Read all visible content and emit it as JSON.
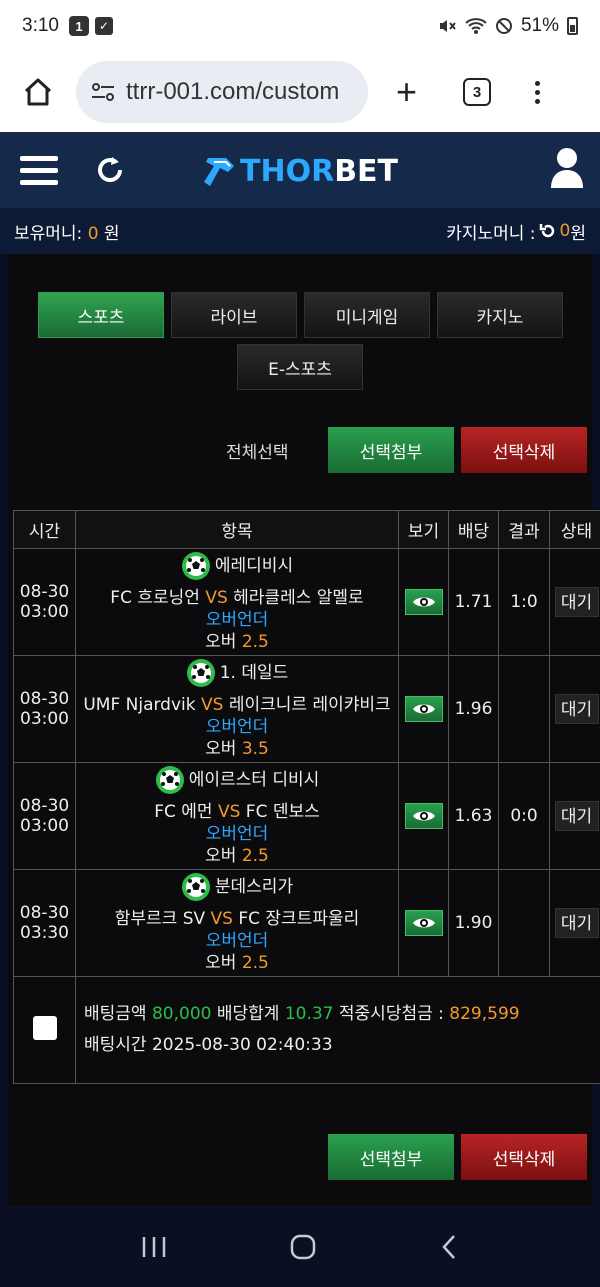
{
  "status_bar": {
    "time": "3:10",
    "notif_count": "1",
    "battery": "51%"
  },
  "browser": {
    "url": "ttrr-001.com/custom",
    "tab_count": "3"
  },
  "site": {
    "logo_part1": "THOR",
    "logo_part2": "BET"
  },
  "money": {
    "holding_label": "보유머니: ",
    "holding_value": "0",
    "holding_unit": " 원",
    "casino_label": "카지노머니 : ",
    "casino_value": "0",
    "casino_unit": " 원"
  },
  "categories": [
    "스포츠",
    "라이브",
    "미니게임",
    "카지노",
    "E-스포츠"
  ],
  "actions": {
    "select_all": "전체선택",
    "attach": "선택첨부",
    "delete": "선택삭제"
  },
  "table": {
    "headers": [
      "시간",
      "항목",
      "보기",
      "배당",
      "결과",
      "상태"
    ],
    "rows": [
      {
        "date": "08-30",
        "time": "03:00",
        "league": "에레디비시",
        "home": "FC 흐로닝언",
        "vs": "VS",
        "away": "헤라클레스 알멜로",
        "market": "오버언더",
        "pick": "오버",
        "line": "2.5",
        "odds": "1.71",
        "result": "1:0",
        "status": "대기"
      },
      {
        "date": "08-30",
        "time": "03:00",
        "league": "1. 데일드",
        "home": "UMF Njardvik",
        "vs": "VS",
        "away": "레이크니르 레이캬비크",
        "market": "오버언더",
        "pick": "오버",
        "line": "3.5",
        "odds": "1.96",
        "result": "",
        "status": "대기"
      },
      {
        "date": "08-30",
        "time": "03:00",
        "league": "에이르스터 디비시",
        "home": "FC 에먼",
        "vs": "VS",
        "away": "FC 덴보스",
        "market": "오버언더",
        "pick": "오버",
        "line": "2.5",
        "odds": "1.63",
        "result": "0:0",
        "status": "대기"
      },
      {
        "date": "08-30",
        "time": "03:30",
        "league": "분데스리가",
        "home": "함부르크 SV",
        "vs": "VS",
        "away": "FC 장크트파울리",
        "market": "오버언더",
        "pick": "오버",
        "line": "2.5",
        "odds": "1.90",
        "result": "",
        "status": "대기"
      }
    ]
  },
  "summary": {
    "bet_amount_label": "배팅금액",
    "bet_amount": "80,000",
    "odds_total_label": "배당합계",
    "odds_total": "10.37",
    "win_label": "적중시당첨금 :",
    "win_amount": "829,599",
    "bet_time_label": "배팅시간",
    "bet_time": "2025-08-30 02:40:33"
  },
  "colors": {
    "accent_orange": "#f29a2e",
    "accent_blue": "#2da8ff",
    "green": "#2ebd4a",
    "red": "#b82424"
  }
}
